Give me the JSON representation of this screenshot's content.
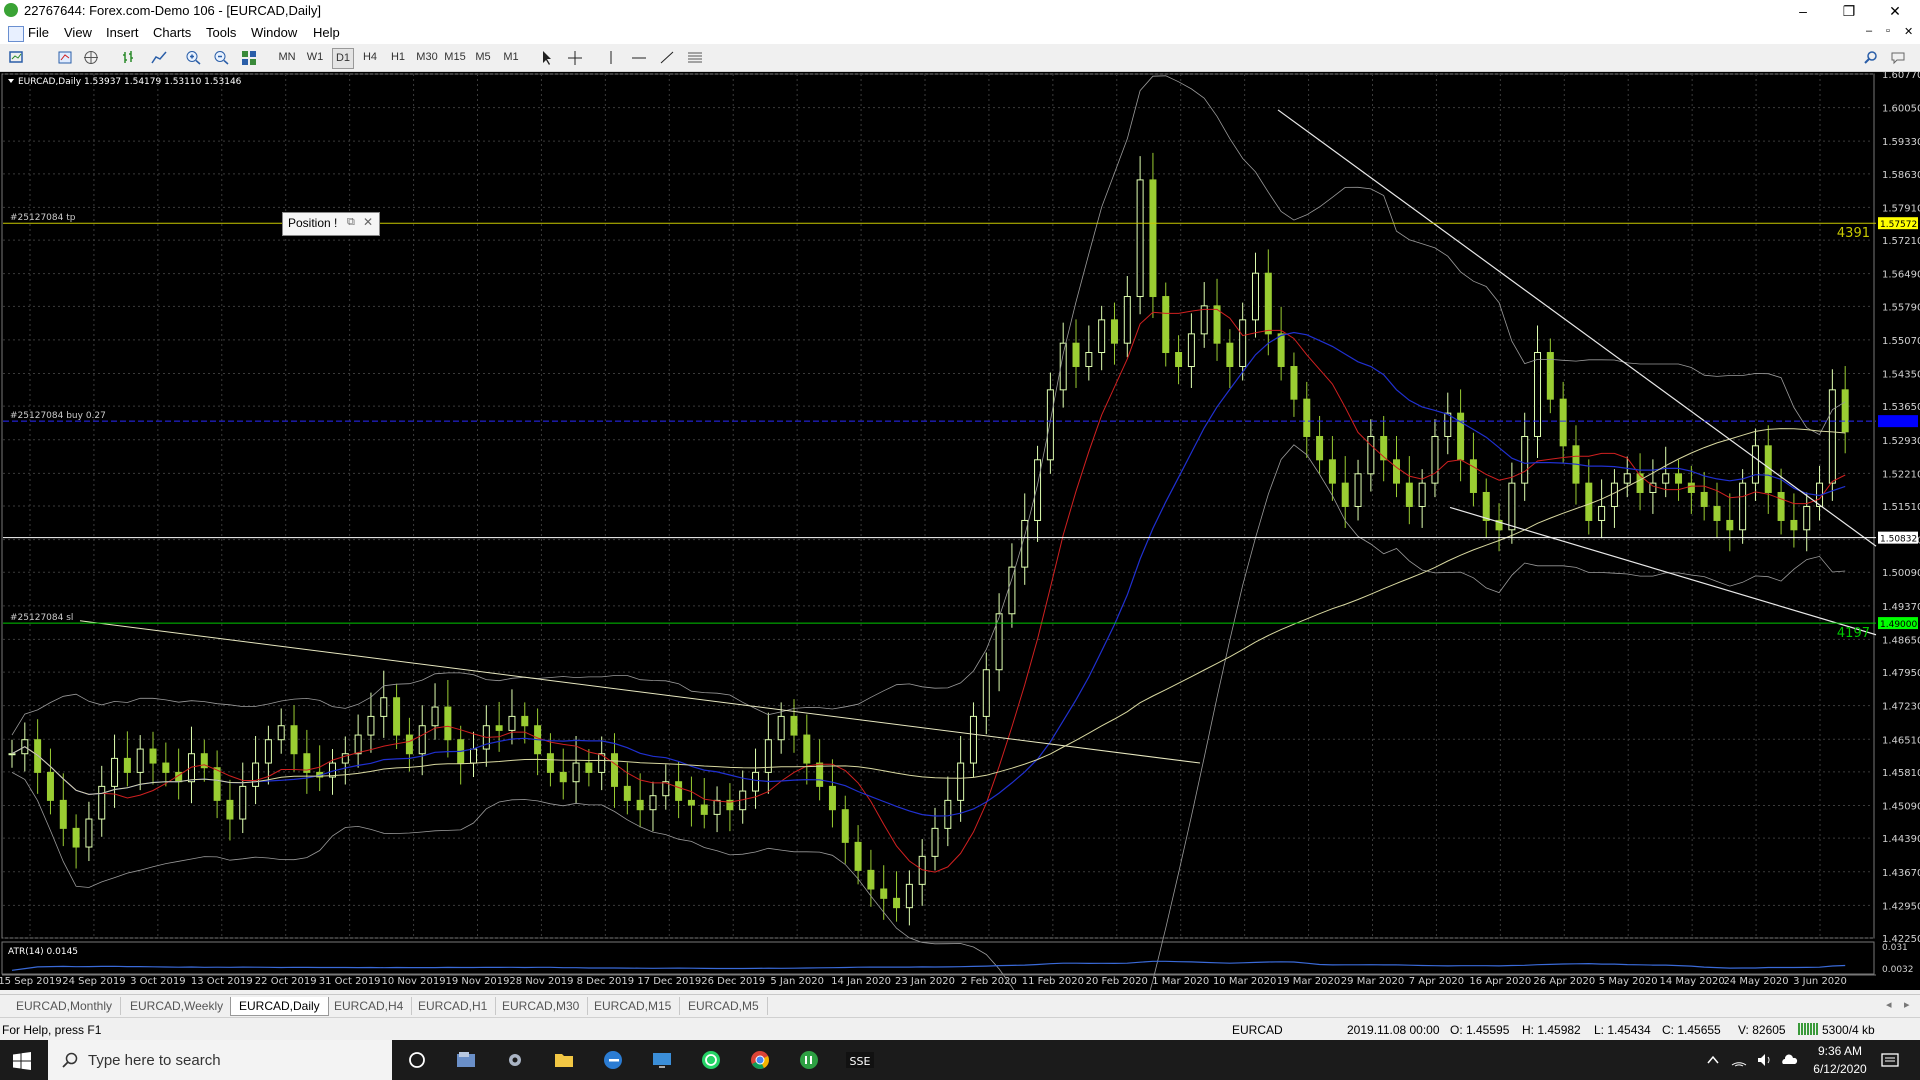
{
  "window": {
    "title": "22767644: Forex.com-Demo 106 - [EURCAD,Daily]",
    "controls": {
      "minimize": "–",
      "maximize": "❐",
      "close": "✕"
    },
    "inner_controls": {
      "minimize": "–",
      "restore": "▫",
      "close": "✕"
    }
  },
  "menu": [
    "File",
    "View",
    "Insert",
    "Charts",
    "Tools",
    "Window",
    "Help"
  ],
  "toolbar": {
    "timeframes": [
      "MN",
      "W1",
      "D1",
      "H4",
      "H1",
      "M30",
      "M15",
      "M5",
      "M1"
    ],
    "active_timeframe": "D1"
  },
  "chart": {
    "header": "EURCAD,Daily  1.53937 1.54179 1.53110 1.53146",
    "position_label": "Position !",
    "tp_label": "#25127084 tp",
    "buy_label": "#25127084 buy 0.27",
    "sl_label": "#25127084 sl",
    "tp_pips": "4391",
    "sl_pips": "4197",
    "tp_price": "1.57572",
    "buy_price": "1.53329",
    "current_price": "1.50832",
    "sl_price": "1.49000",
    "atr_label": "ATR(14) 0.0145",
    "atr_axis": [
      "0.031",
      "0.0032"
    ],
    "colors": {
      "background": "#000000",
      "grid": "#3b3b3b",
      "up": "#dfffb0",
      "down": "#9acd32",
      "tp_line": "#c8c800",
      "sl_line": "#00c800",
      "buy_line": "#2a2aff",
      "ma_red": "#d02020",
      "ma_blue": "#2030d0"
    }
  },
  "chart_data": {
    "type": "candlestick",
    "symbol": "EURCAD",
    "timeframe": "Daily",
    "y_ticks": [
      "1.60770",
      "1.60050",
      "1.59330",
      "1.58630",
      "1.57910",
      "1.57210",
      "1.56490",
      "1.55790",
      "1.55070",
      "1.54350",
      "1.53650",
      "1.52930",
      "1.52210",
      "1.51510",
      "1.50790",
      "1.50090",
      "1.49370",
      "1.48650",
      "1.47950",
      "1.47230",
      "1.46510",
      "1.45810",
      "1.45090",
      "1.44390",
      "1.43670",
      "1.42950",
      "1.42250"
    ],
    "x_ticks": [
      "15 Sep 2019",
      "24 Sep 2019",
      "3 Oct 2019",
      "13 Oct 2019",
      "22 Oct 2019",
      "31 Oct 2019",
      "10 Nov 2019",
      "19 Nov 2019",
      "28 Nov 2019",
      "8 Dec 2019",
      "17 Dec 2019",
      "26 Dec 2019",
      "5 Jan 2020",
      "14 Jan 2020",
      "23 Jan 2020",
      "2 Feb 2020",
      "11 Feb 2020",
      "20 Feb 2020",
      "1 Mar 2020",
      "10 Mar 2020",
      "19 Mar 2020",
      "29 Mar 2020",
      "7 Apr 2020",
      "16 Apr 2020",
      "26 Apr 2020",
      "5 May 2020",
      "14 May 2020",
      "24 May 2020",
      "3 Jun 2020"
    ],
    "ylim": [
      1.4225,
      1.6077
    ],
    "close_path": [
      1.462,
      1.465,
      1.458,
      1.452,
      1.446,
      1.442,
      1.448,
      1.455,
      1.461,
      1.458,
      1.463,
      1.46,
      1.458,
      1.456,
      1.462,
      1.459,
      1.452,
      1.448,
      1.455,
      1.46,
      1.465,
      1.468,
      1.462,
      1.458,
      1.457,
      1.46,
      1.462,
      1.466,
      1.47,
      1.474,
      1.466,
      1.462,
      1.468,
      1.472,
      1.465,
      1.46,
      1.463,
      1.468,
      1.467,
      1.47,
      1.468,
      1.462,
      1.458,
      1.456,
      1.46,
      1.458,
      1.462,
      1.455,
      1.452,
      1.45,
      1.453,
      1.456,
      1.452,
      1.451,
      1.449,
      1.452,
      1.45,
      1.454,
      1.458,
      1.465,
      1.47,
      1.466,
      1.46,
      1.455,
      1.45,
      1.443,
      1.437,
      1.433,
      1.431,
      1.429,
      1.434,
      1.44,
      1.446,
      1.452,
      1.46,
      1.47,
      1.48,
      1.492,
      1.502,
      1.512,
      1.525,
      1.54,
      1.55,
      1.545,
      1.548,
      1.555,
      1.55,
      1.56,
      1.585,
      1.56,
      1.548,
      1.545,
      1.552,
      1.558,
      1.55,
      1.545,
      1.555,
      1.565,
      1.552,
      1.545,
      1.538,
      1.53,
      1.525,
      1.52,
      1.515,
      1.522,
      1.53,
      1.525,
      1.52,
      1.515,
      1.52,
      1.53,
      1.535,
      1.525,
      1.518,
      1.512,
      1.51,
      1.52,
      1.53,
      1.548,
      1.538,
      1.528,
      1.52,
      1.512,
      1.515,
      1.52,
      1.522,
      1.518,
      1.52,
      1.522,
      1.52,
      1.518,
      1.515,
      1.512,
      1.51,
      1.52,
      1.528,
      1.518,
      1.512,
      1.51,
      1.515,
      1.52,
      1.54,
      1.531
    ]
  },
  "tabs": [
    "EURCAD,Monthly",
    "EURCAD,Weekly",
    "EURCAD,Daily",
    "EURCAD,H4",
    "EURCAD,H1",
    "EURCAD,M30",
    "EURCAD,M15",
    "EURCAD,M5"
  ],
  "active_tab": "EURCAD,Daily",
  "status": {
    "help": "For Help, press F1",
    "symbol": "EURCAD",
    "datetime": "2019.11.08 00:00",
    "open": "O: 1.45595",
    "high": "H: 1.45982",
    "low": "L: 1.45434",
    "close": "C: 1.45655",
    "volume": "V: 82605",
    "traffic": "5300/4 kb"
  },
  "taskbar": {
    "search_placeholder": "Type here to search",
    "time": "9:36 AM",
    "date": "6/12/2020"
  }
}
